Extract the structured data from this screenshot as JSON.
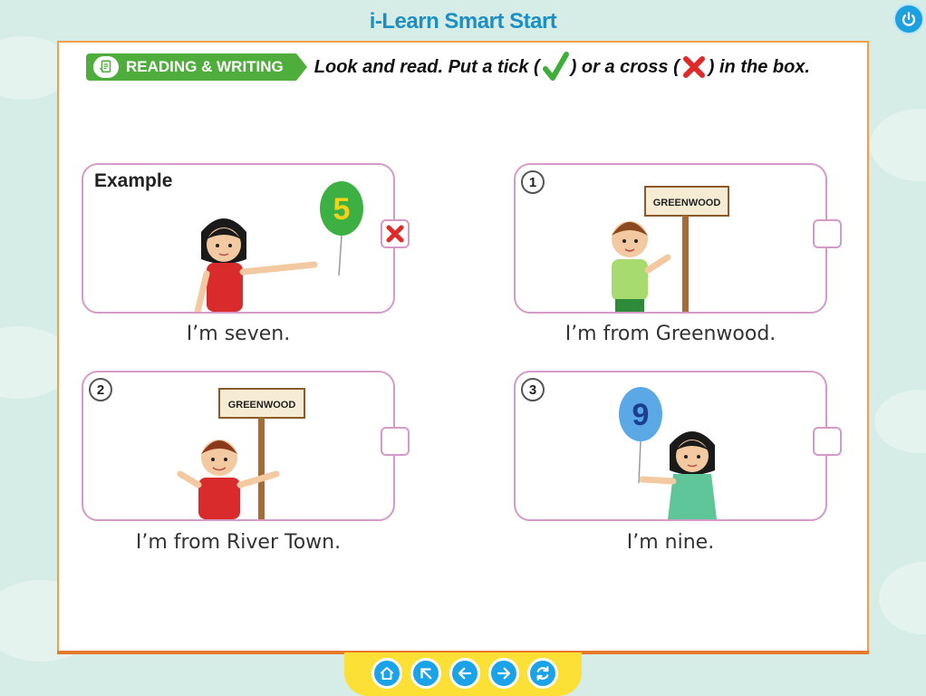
{
  "app": {
    "title": "i-Learn Smart Start"
  },
  "section": {
    "skill_label": "READING & WRITING",
    "instruction_part1": "Look and read. Put a tick (",
    "instruction_part2": ") or a cross (",
    "instruction_part3": ") in the box."
  },
  "items": [
    {
      "label": "Example",
      "caption": "I’m seven.",
      "answer": "cross",
      "balloon_number": "5"
    },
    {
      "label": "1",
      "caption": "I’m from Greenwood.",
      "answer": "",
      "sign_text": "GREENWOOD"
    },
    {
      "label": "2",
      "caption": "I’m from River Town.",
      "answer": "",
      "sign_text": "GREENWOOD"
    },
    {
      "label": "3",
      "caption": "I’m nine.",
      "answer": "",
      "balloon_number": "9"
    }
  ],
  "navigation": {
    "buttons": [
      "home-icon",
      "arrow-up-left-icon",
      "arrow-left-icon",
      "arrow-right-icon",
      "refresh-icon"
    ]
  },
  "colors": {
    "accent": "#1da0e0",
    "skill_tag": "#4fae3b",
    "card_border": "#d49ac8",
    "page_border": "#f0a04b",
    "nav_bar": "#fde036"
  }
}
